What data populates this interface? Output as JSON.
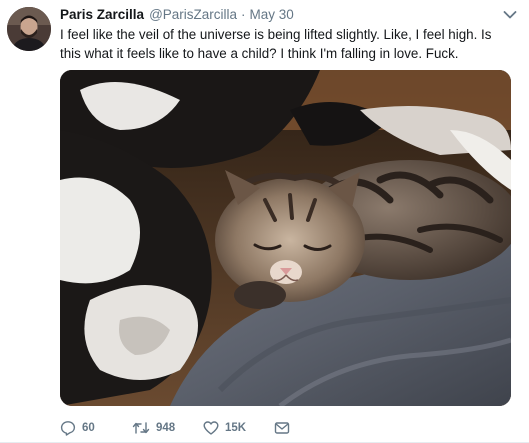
{
  "tweet": {
    "display_name": "Paris Zarcilla",
    "handle": "@ParisZarcilla",
    "separator": "·",
    "timestamp": "May 30",
    "text": "I feel like the veil of the universe is being lifted slightly. Like, I feel high. Is this what it feels like to have a child? I think I'm falling in love. Fuck.",
    "media_icon": "photo-of-sleeping-kittens"
  },
  "actions": {
    "reply_count": "60",
    "retweet_count": "948",
    "like_count": "15K",
    "reply_icon": "reply-icon",
    "retweet_icon": "retweet-icon",
    "like_icon": "heart-icon",
    "dm_icon": "envelope-icon"
  },
  "colors": {
    "text_primary": "#14171a",
    "text_secondary": "#657786",
    "border": "#e6ecf0",
    "background": "#ffffff"
  }
}
